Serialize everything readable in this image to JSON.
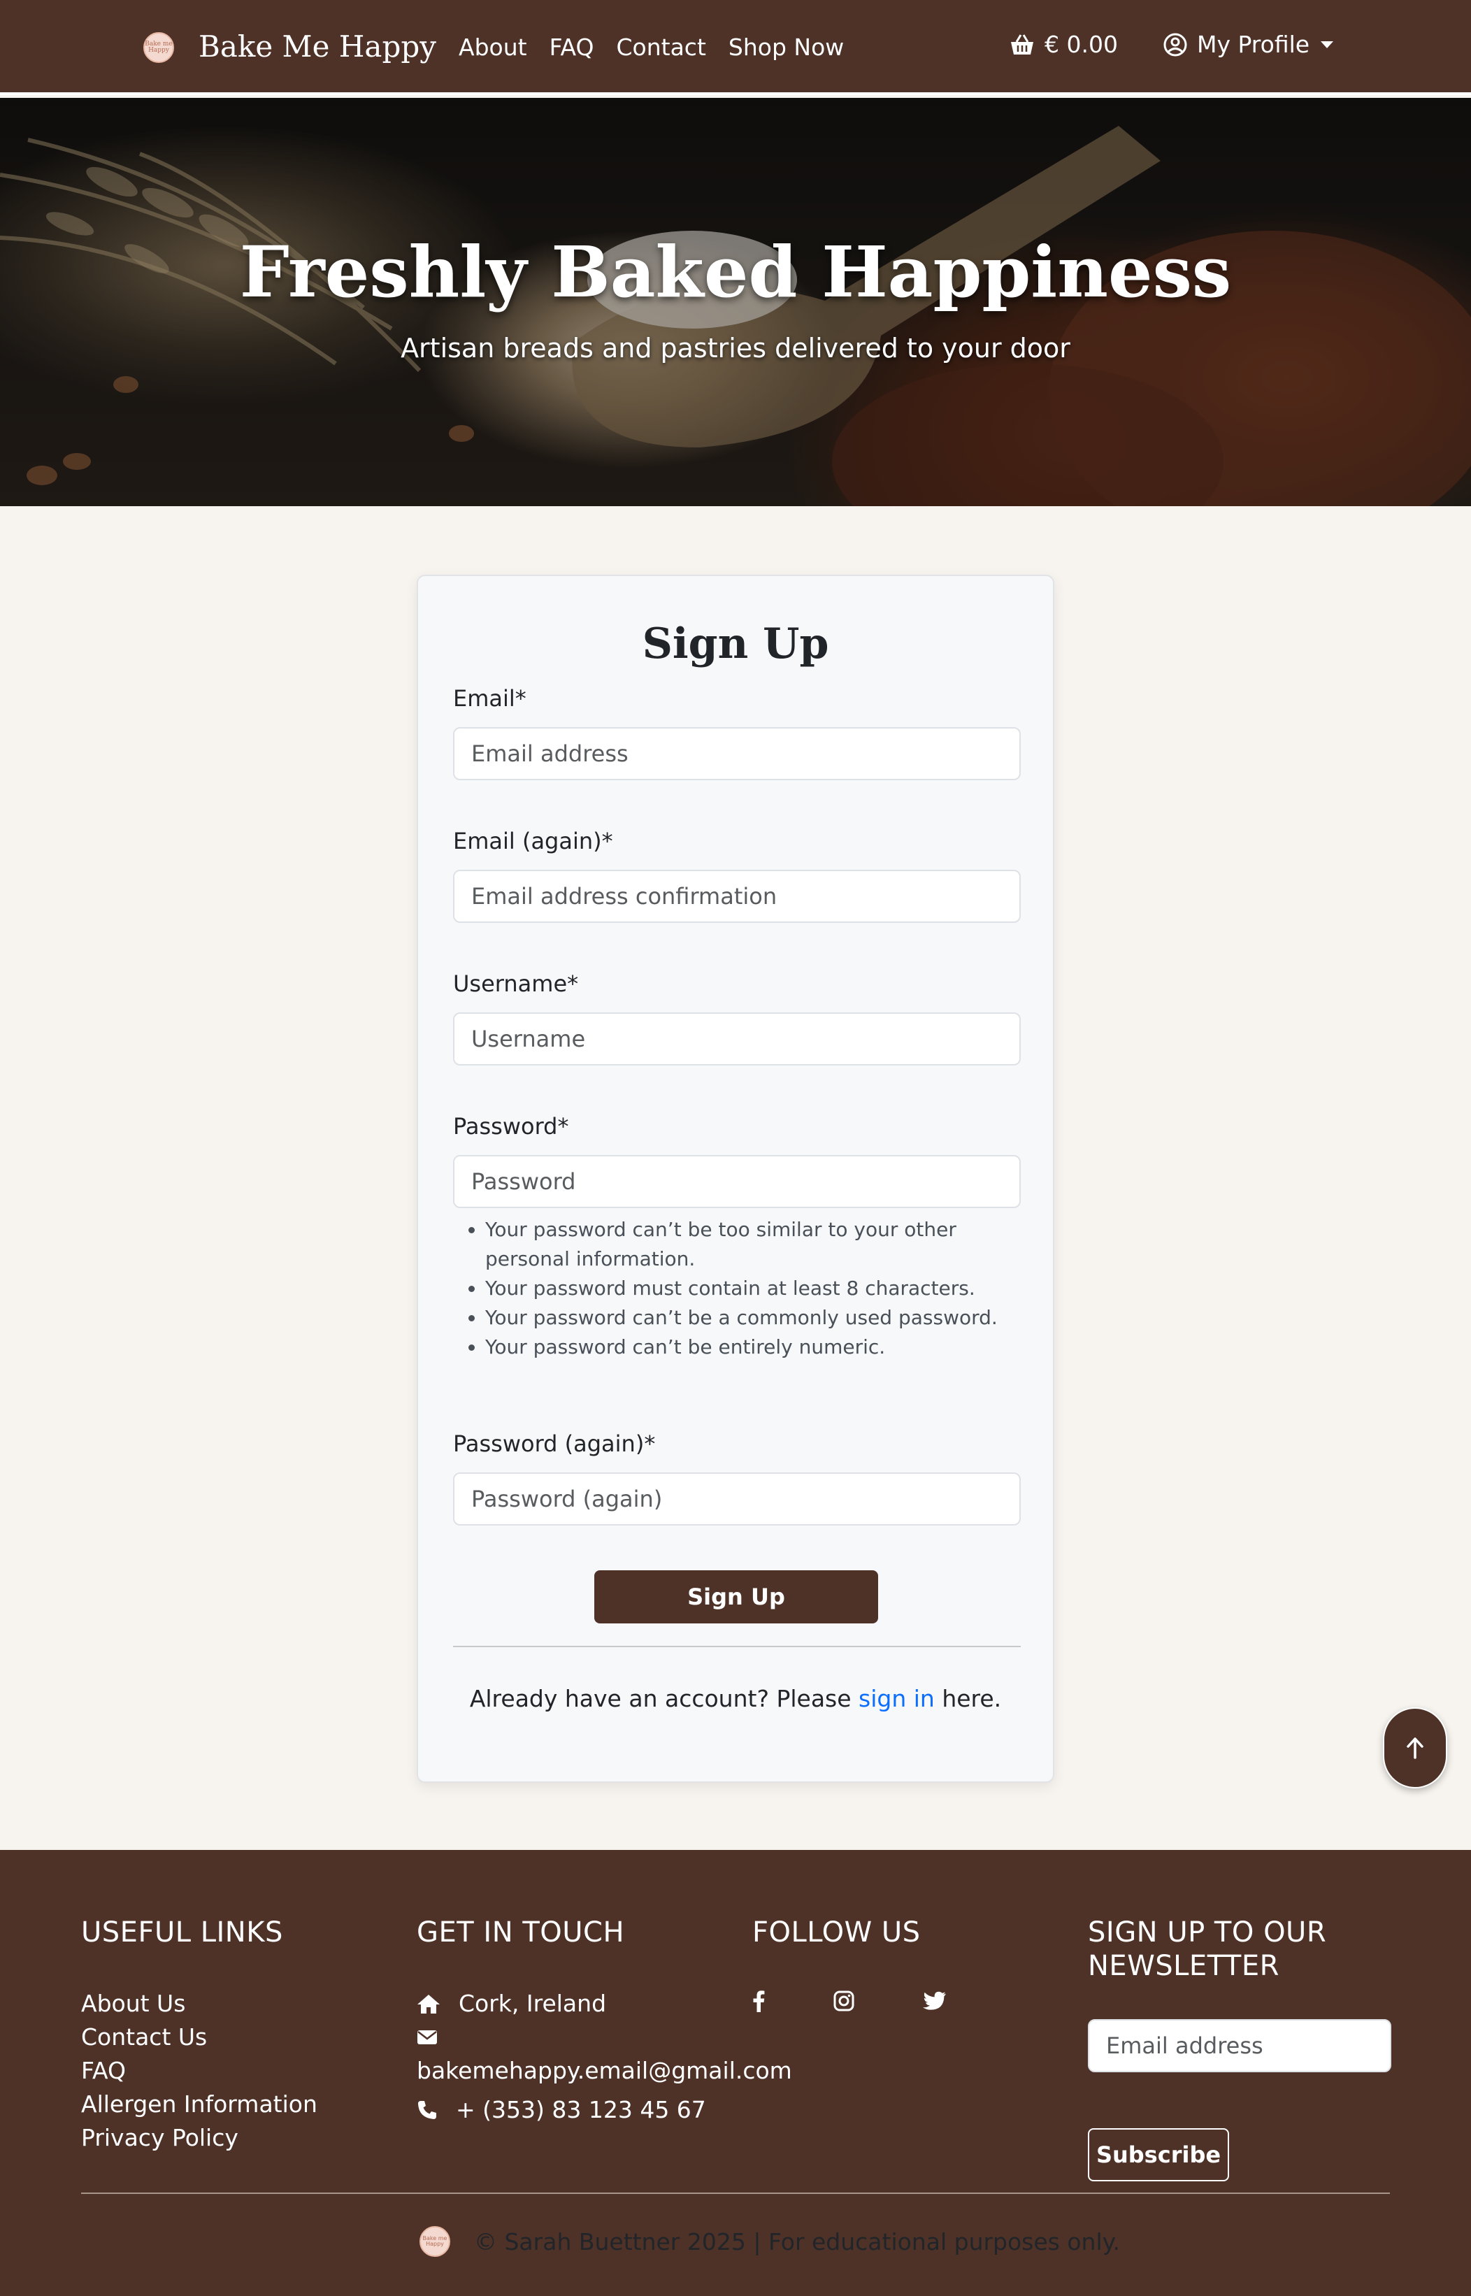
{
  "navbar": {
    "logo_text": "Bake Me Happy",
    "brand": "Bake Me Happy",
    "links": [
      "About",
      "FAQ",
      "Contact",
      "Shop Now"
    ],
    "basket_total": "€ 0.00",
    "profile_label": "My Profile"
  },
  "hero": {
    "title": "Freshly Baked Happiness",
    "subtitle": "Artisan breads and pastries delivered to your door"
  },
  "signup": {
    "title": "Sign Up",
    "fields": [
      {
        "label": "Email*",
        "placeholder": "Email address"
      },
      {
        "label": "Email (again)*",
        "placeholder": "Email address confirmation"
      },
      {
        "label": "Username*",
        "placeholder": "Username"
      },
      {
        "label": "Password*",
        "placeholder": "Password"
      },
      {
        "label": "Password (again)*",
        "placeholder": "Password (again)"
      }
    ],
    "password_help": [
      "Your password can’t be too similar to your other personal information.",
      "Your password must contain at least 8 characters.",
      "Your password can’t be a commonly used password.",
      "Your password can’t be entirely numeric."
    ],
    "button": "Sign Up",
    "signin_prefix": "Already have an account? Please ",
    "signin_link": "sign in",
    "signin_suffix": " here."
  },
  "footer": {
    "useful_links_title": "USEFUL LINKS",
    "useful_links": [
      "About Us",
      "Contact Us",
      "FAQ",
      "Allergen Information",
      "Privacy Policy"
    ],
    "contact_title": "GET IN TOUCH",
    "location": "Cork, Ireland",
    "email": "bakemehappy.email@gmail.com",
    "phone": "+ (353) 83 123 45 67",
    "follow_title": "FOLLOW US",
    "social_icons": [
      "facebook-icon",
      "instagram-icon",
      "twitter-icon"
    ],
    "newsletter_title_1": "SIGN UP TO OUR",
    "newsletter_title_2": "NEWSLETTER",
    "newsletter_placeholder": "Email address",
    "subscribe_label": "Subscribe",
    "copyright": "© Sarah Buettner 2025 | For educational purposes only."
  },
  "colors": {
    "brand_brown": "#4e3228",
    "link_blue": "#0d6efd",
    "page_bg": "#f7f4ef",
    "card_bg": "#f7f8fa"
  }
}
